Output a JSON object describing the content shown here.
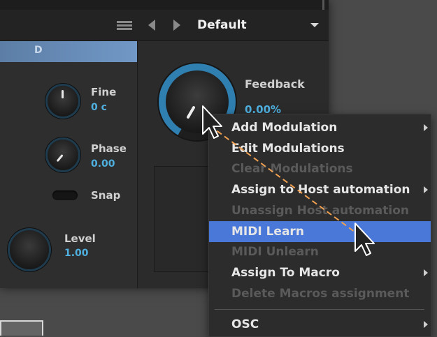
{
  "toolbar": {
    "menu_icon": "hamburger-menu-icon",
    "prev_icon": "previous-preset-icon",
    "next_icon": "next-preset-icon",
    "preset_name": "Default"
  },
  "left_panel": {
    "header_label": "D",
    "controls": [
      {
        "label": "Fine",
        "value": "0 c"
      },
      {
        "label": "Phase",
        "value": "0.00"
      },
      {
        "label": "Snap"
      },
      {
        "label": "Level",
        "value": "1.00"
      }
    ]
  },
  "right_panel": {
    "feedback_label": "Feedback",
    "feedback_value": "0.00%"
  },
  "context_menu": {
    "items": [
      {
        "label": "Add Modulation",
        "enabled": true,
        "submenu": true
      },
      {
        "label": "Edit Modulations",
        "enabled": true,
        "submenu": false
      },
      {
        "label": "Clear Modulations",
        "enabled": false,
        "submenu": false
      },
      {
        "label": "Assign to Host automation",
        "enabled": true,
        "submenu": true
      },
      {
        "label": "Unassign Host automation",
        "enabled": false,
        "submenu": false
      },
      {
        "label": "MIDI Learn",
        "enabled": true,
        "submenu": false,
        "highlighted": true
      },
      {
        "label": "MIDI Unlearn",
        "enabled": false,
        "submenu": false
      },
      {
        "label": "Assign To Macro",
        "enabled": true,
        "submenu": true
      },
      {
        "label": "Delete Macros assignment",
        "enabled": false,
        "submenu": false
      },
      {
        "label": "OSC",
        "enabled": true,
        "submenu": true
      }
    ]
  },
  "colors": {
    "accent_blue": "#4fb0e0",
    "highlight": "#4a78d8",
    "drag_path": "#e08a3a"
  }
}
